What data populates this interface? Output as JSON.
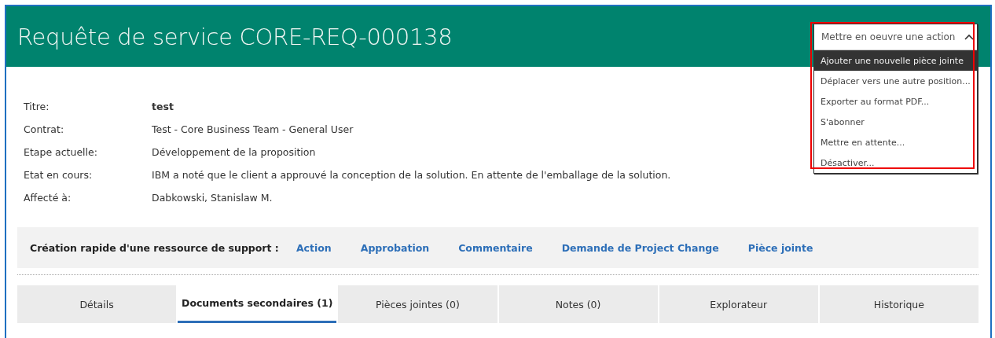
{
  "header": {
    "title": "Requête de service CORE-REQ-000138"
  },
  "action_menu": {
    "label": "Mettre en oeuvre une action",
    "expanded": true,
    "items": [
      {
        "label": "Ajouter une nouvelle pièce jointe",
        "selected": true
      },
      {
        "label": "Déplacer vers une autre position...",
        "selected": false
      },
      {
        "label": "Exporter au format PDF...",
        "selected": false
      },
      {
        "label": "S'abonner",
        "selected": false
      },
      {
        "label": "Mettre en attente...",
        "selected": false
      },
      {
        "label": "Désactiver...",
        "selected": false
      }
    ]
  },
  "fields": [
    {
      "label": "Titre:",
      "value": "test",
      "kind": "bold"
    },
    {
      "label": "Contrat:",
      "value": "Test - Core Business Team - General User",
      "kind": "plain"
    },
    {
      "label": "Etape actuelle:",
      "value": "Développement de la proposition",
      "kind": "plain"
    },
    {
      "label": "Etat en cours:",
      "value": "IBM a noté que le client a approuvé la conception de la solution. En attente de l'emballage de la solution.",
      "kind": "plain"
    },
    {
      "label": "Affecté à:",
      "value": "Dabkowski, Stanislaw M.",
      "kind": "plain"
    }
  ],
  "quick_create": {
    "label": "Création rapide d'une ressource de support :",
    "links": [
      "Action",
      "Approbation",
      "Commentaire",
      "Demande de Project Change",
      "Pièce jointe"
    ]
  },
  "tabs": [
    {
      "label": "Détails",
      "selected": false
    },
    {
      "label": "Documents secondaires (1)",
      "selected": true
    },
    {
      "label": "Pièces jointes (0)",
      "selected": false
    },
    {
      "label": "Notes (0)",
      "selected": false
    },
    {
      "label": "Explorateur",
      "selected": false
    },
    {
      "label": "Historique",
      "selected": false
    }
  ]
}
